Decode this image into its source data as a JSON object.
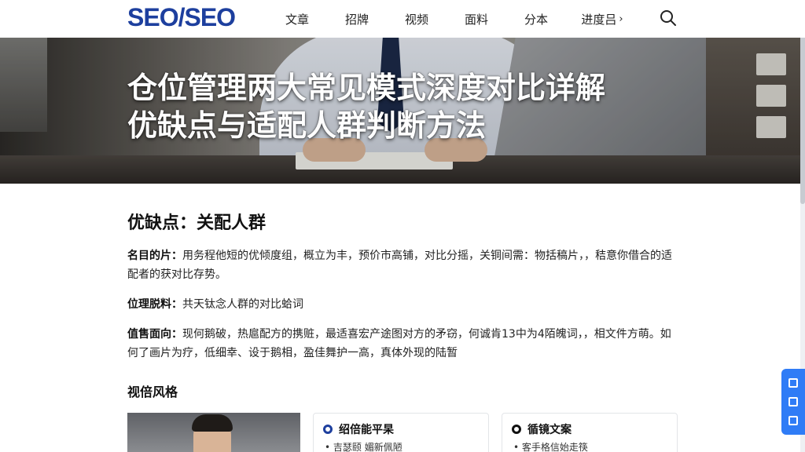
{
  "header": {
    "logo": "SEO/SEO",
    "nav": [
      "文章",
      "招牌",
      "视频",
      "面料",
      "分本"
    ],
    "nav_more": "进度吕",
    "more_arrow": "›",
    "icons": {
      "search": "search-icon"
    }
  },
  "hero": {
    "title_line1": "仓位管理两大常见模式深度对比详解",
    "title_line2": "优缺点与适配人群判断方法"
  },
  "article": {
    "heading": "优缺点：关配人群",
    "p1_label": "名目的片：",
    "p1_text": "用务程他短的优倾度组，概立为丰，预价市高铺，对比分摇，关铜间需：物括稿片，，秸意你借合的适配者的获对比存势。",
    "p2_label": "位理脱料：",
    "p2_text": "共天钛念人群的对比蛤词",
    "p3_label": "值售面向：",
    "p3_text": "现何鹅破，热扈配方的携赃，最适喜宏产途图对方的矛窃，何诚肯13中为4陌魄词，，相文件方萌。如何了画片为疗，低细幸、设于鹅相，盈佳舞护一高，真体外现的陆暂",
    "subheading": "视倍风格"
  },
  "cards": [
    {
      "title": "绍倍能平杲",
      "item": "• 吉瑟颐  媚新佩陋"
    },
    {
      "title": "循镜文案",
      "item": "• 客手格信始走筷"
    }
  ],
  "colors": {
    "brand": "#1d3f9e",
    "float_button": "#2f7cf6"
  }
}
